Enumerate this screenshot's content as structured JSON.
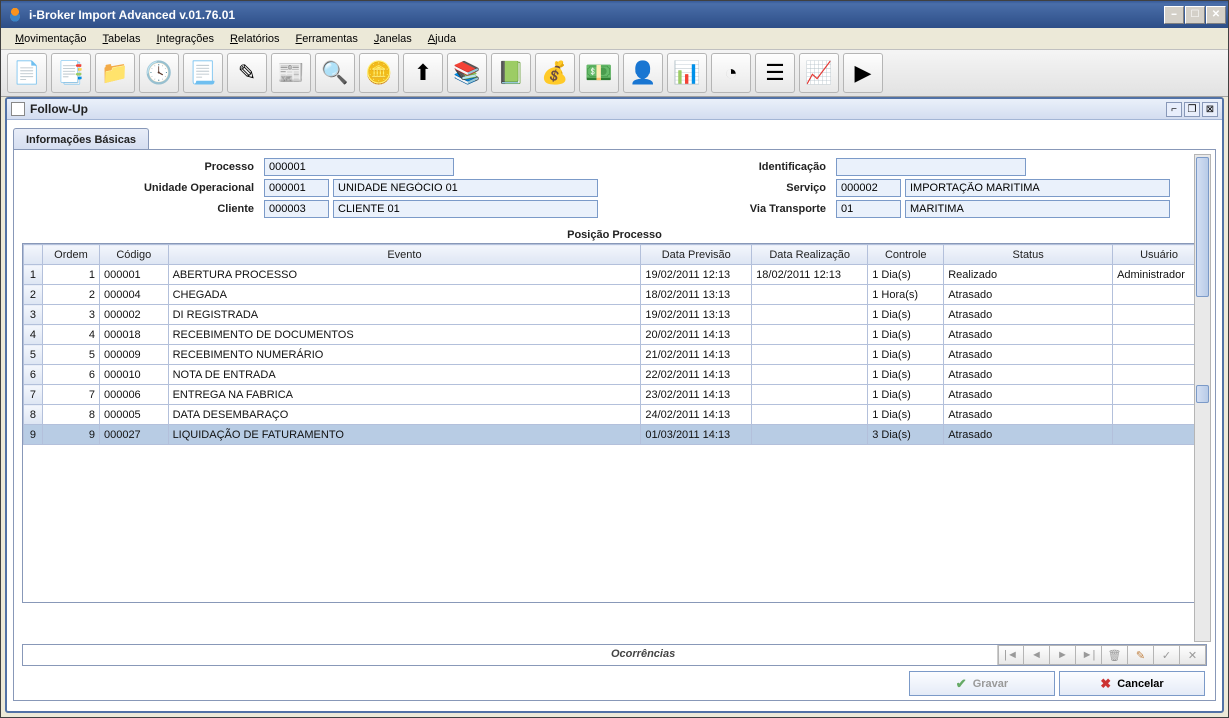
{
  "window": {
    "title": "i-Broker Import Advanced v.01.76.01"
  },
  "menu": {
    "items": [
      "Movimentação",
      "Tabelas",
      "Integrações",
      "Relatórios",
      "Ferramentas",
      "Janelas",
      "Ajuda"
    ]
  },
  "toolbar_icons": [
    "document-icon",
    "documents-icon",
    "folder-star-icon",
    "folder-clock-icon",
    "page-icon",
    "edit-icon",
    "doc-lines-icon",
    "search-icon",
    "coins-icon",
    "arrow-up-icon",
    "books-icon",
    "ledger-icon",
    "money-pin-icon",
    "money-chart-icon",
    "pie-user-icon",
    "bar-chart-icon",
    "pie-slice-icon",
    "list-icon",
    "chart-arrow-icon",
    "play-icon"
  ],
  "inner_window": {
    "title": "Follow-Up"
  },
  "tab": {
    "label": "Informações Básicas"
  },
  "form": {
    "processo_label": "Processo",
    "processo_value": "000001",
    "unidade_label": "Unidade Operacional",
    "unidade_code": "000001",
    "unidade_name": "UNIDADE NEGÓCIO 01",
    "cliente_label": "Cliente",
    "cliente_code": "000003",
    "cliente_name": "CLIENTE 01",
    "identificacao_label": "Identificação",
    "identificacao_value": "",
    "servico_label": "Serviço",
    "servico_code": "000002",
    "servico_name": "IMPORTAÇÃO MARITIMA",
    "via_label": "Via Transporte",
    "via_code": "01",
    "via_name": "MARITIMA"
  },
  "table": {
    "caption": "Posição Processo",
    "headers": {
      "ordem": "Ordem",
      "codigo": "Código",
      "evento": "Evento",
      "data_prev": "Data Previsão",
      "data_real": "Data Realização",
      "controle": "Controle",
      "status": "Status",
      "usuario": "Usuário"
    },
    "rows": [
      {
        "n": "1",
        "ordem": "1",
        "codigo": "000001",
        "evento": "ABERTURA PROCESSO",
        "data_prev": "19/02/2011 12:13",
        "data_real": "18/02/2011 12:13",
        "controle": "1 Dia(s)",
        "status": "Realizado",
        "usuario": "Administrador",
        "sel": false
      },
      {
        "n": "2",
        "ordem": "2",
        "codigo": "000004",
        "evento": "CHEGADA",
        "data_prev": "18/02/2011 13:13",
        "data_real": "",
        "controle": "1 Hora(s)",
        "status": "Atrasado",
        "usuario": "",
        "sel": false
      },
      {
        "n": "3",
        "ordem": "3",
        "codigo": "000002",
        "evento": "DI REGISTRADA",
        "data_prev": "19/02/2011 13:13",
        "data_real": "",
        "controle": "1 Dia(s)",
        "status": "Atrasado",
        "usuario": "",
        "sel": false
      },
      {
        "n": "4",
        "ordem": "4",
        "codigo": "000018",
        "evento": "RECEBIMENTO DE DOCUMENTOS",
        "data_prev": "20/02/2011 14:13",
        "data_real": "",
        "controle": "1 Dia(s)",
        "status": "Atrasado",
        "usuario": "",
        "sel": false
      },
      {
        "n": "5",
        "ordem": "5",
        "codigo": "000009",
        "evento": "RECEBIMENTO NUMERÁRIO",
        "data_prev": "21/02/2011 14:13",
        "data_real": "",
        "controle": "1 Dia(s)",
        "status": "Atrasado",
        "usuario": "",
        "sel": false
      },
      {
        "n": "6",
        "ordem": "6",
        "codigo": "000010",
        "evento": "NOTA DE ENTRADA",
        "data_prev": "22/02/2011 14:13",
        "data_real": "",
        "controle": "1 Dia(s)",
        "status": "Atrasado",
        "usuario": "",
        "sel": false
      },
      {
        "n": "7",
        "ordem": "7",
        "codigo": "000006",
        "evento": "ENTREGA NA FABRICA",
        "data_prev": "23/02/2011 14:13",
        "data_real": "",
        "controle": "1 Dia(s)",
        "status": "Atrasado",
        "usuario": "",
        "sel": false
      },
      {
        "n": "8",
        "ordem": "8",
        "codigo": "000005",
        "evento": "DATA DESEMBARAÇO",
        "data_prev": "24/02/2011 14:13",
        "data_real": "",
        "controle": "1 Dia(s)",
        "status": "Atrasado",
        "usuario": "",
        "sel": false
      },
      {
        "n": "9",
        "ordem": "9",
        "codigo": "000027",
        "evento": "LIQUIDAÇÃO DE FATURAMENTO",
        "data_prev": "01/03/2011 14:13",
        "data_real": "",
        "controle": "3 Dia(s)",
        "status": "Atrasado",
        "usuario": "",
        "sel": true
      }
    ]
  },
  "bottom": {
    "ocorrencias": "Ocorrências"
  },
  "buttons": {
    "gravar": "Gravar",
    "cancelar": "Cancelar"
  }
}
